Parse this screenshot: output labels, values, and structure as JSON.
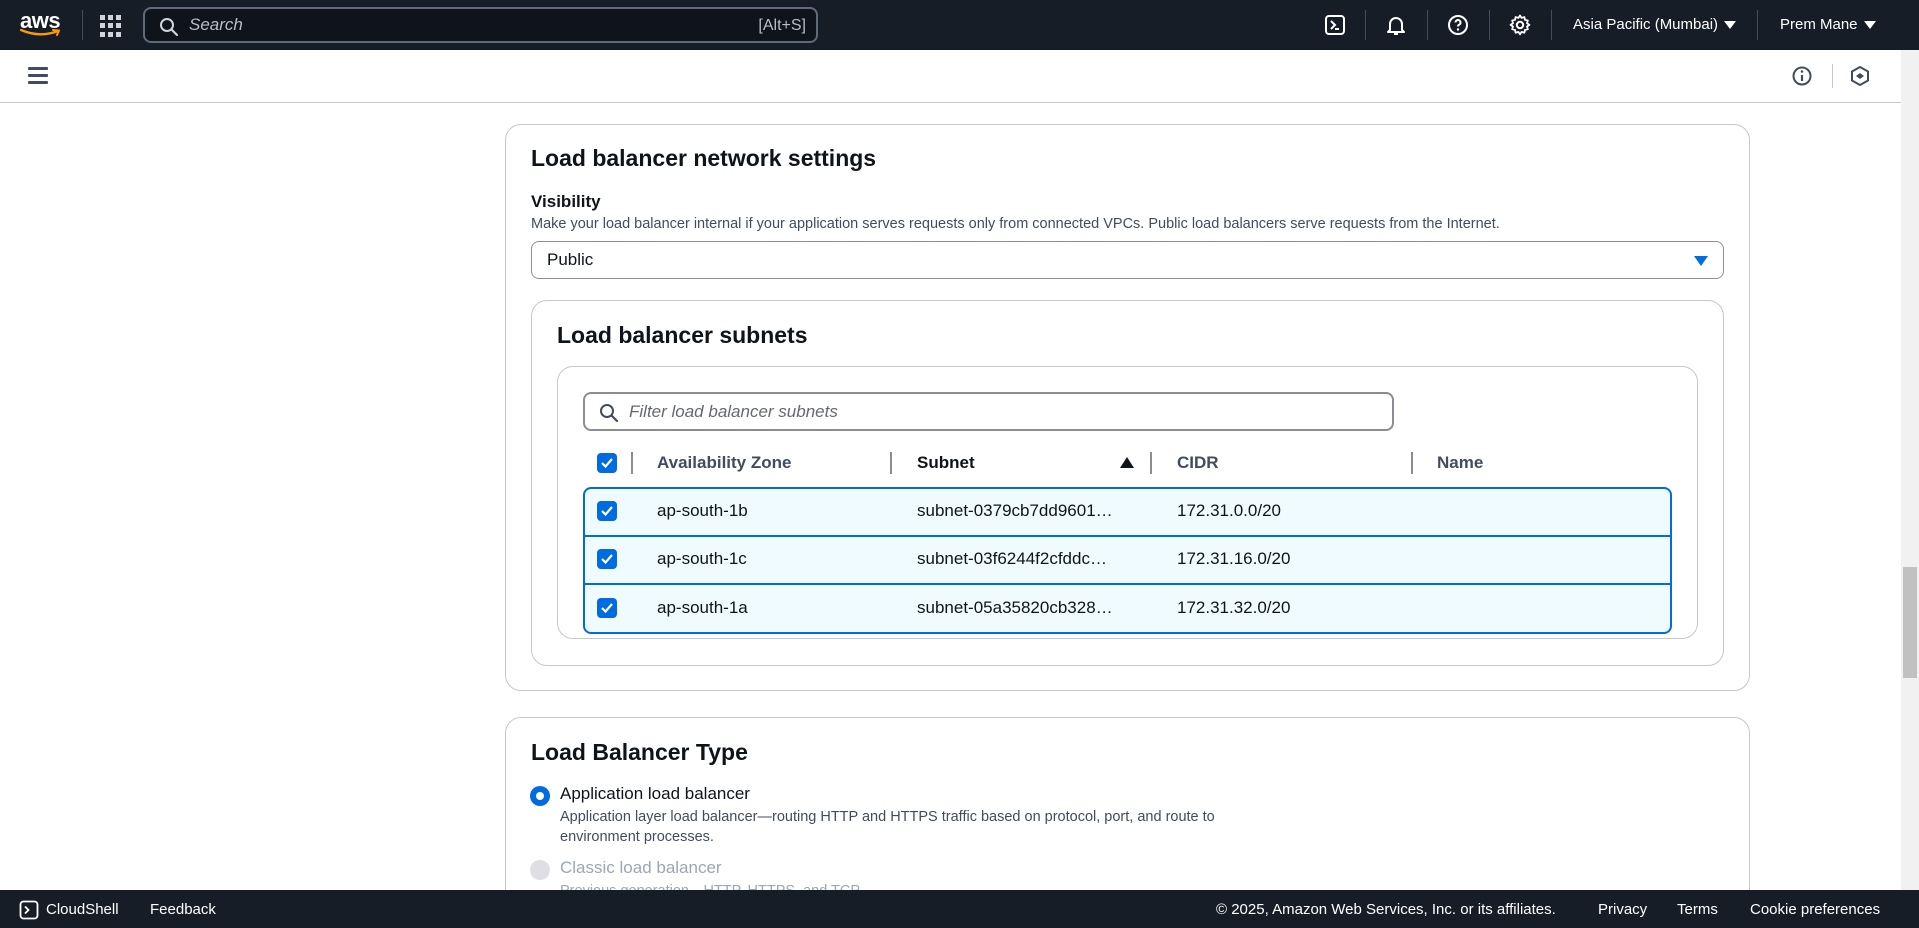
{
  "topnav": {
    "logo_text": "aws",
    "search_placeholder": "Search",
    "search_shortcut": "[Alt+S]",
    "region": "Asia Pacific (Mumbai)",
    "user": "Prem Mane"
  },
  "network": {
    "title": "Load balancer network settings",
    "visibility_label": "Visibility",
    "visibility_desc": "Make your load balancer internal if your application serves requests only from connected VPCs. Public load balancers serve requests from the Internet.",
    "visibility_value": "Public"
  },
  "subnets": {
    "title": "Load balancer subnets",
    "filter_placeholder": "Filter load balancer subnets",
    "columns": [
      "Availability Zone",
      "Subnet",
      "CIDR",
      "Name"
    ],
    "rows": [
      {
        "az": "ap-south-1b",
        "subnet": "subnet-0379cb7dd9601…",
        "cidr": "172.31.0.0/20",
        "name": ""
      },
      {
        "az": "ap-south-1c",
        "subnet": "subnet-03f6244f2cfddc…",
        "cidr": "172.31.16.0/20",
        "name": ""
      },
      {
        "az": "ap-south-1a",
        "subnet": "subnet-05a35820cb328…",
        "cidr": "172.31.32.0/20",
        "name": ""
      }
    ]
  },
  "lbtype": {
    "title": "Load Balancer Type",
    "options": [
      {
        "label": "Application load balancer",
        "desc_line1": "Application layer load balancer—routing HTTP and HTTPS traffic based on protocol, port, and route to",
        "desc_line2": "environment processes.",
        "selected": true
      },
      {
        "label": "Classic load balancer",
        "desc_line1": "Previous generation—HTTP, HTTPS, and TCP",
        "selected": false
      }
    ]
  },
  "footer": {
    "cloudshell": "CloudShell",
    "feedback": "Feedback",
    "copyright": "© 2025, Amazon Web Services, Inc. or its affiliates.",
    "privacy": "Privacy",
    "terms": "Terms",
    "cookies": "Cookie preferences"
  },
  "colors": {
    "nav_bg": "#161d26",
    "accent": "#006ce0",
    "row_bg": "#f0fbff"
  }
}
